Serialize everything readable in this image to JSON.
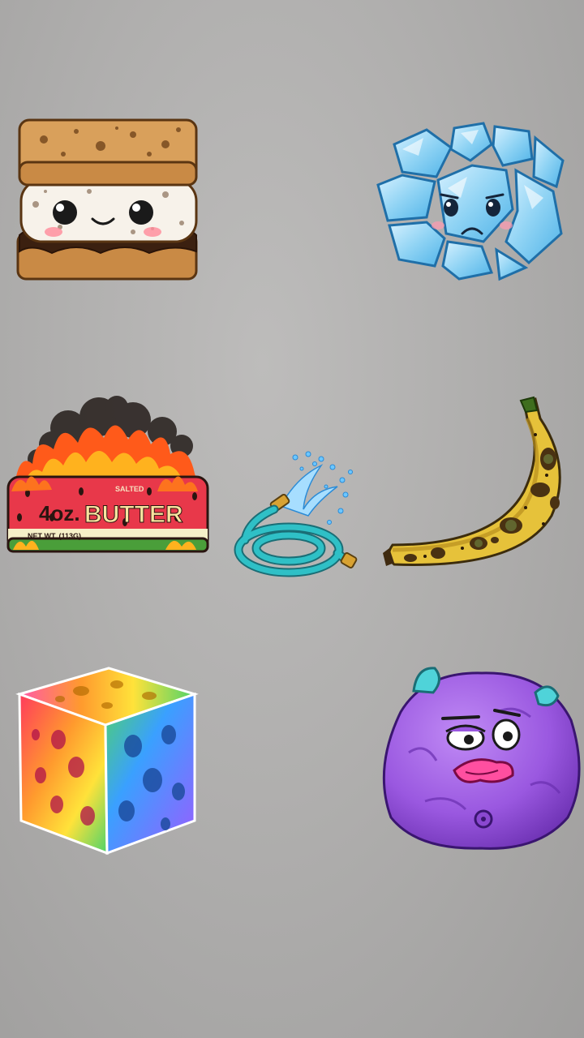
{
  "colors": {
    "wall": "#b0afae",
    "graham": "#d9a05b",
    "marshmallow": "#f7f2ea",
    "chocolate": "#3b2010",
    "ice": "#8fd3f4",
    "butter_red": "#e8384a",
    "hose": "#29a8b0",
    "banana": "#e6c23a",
    "sponge_rainbow": [
      "#ff3b5c",
      "#ff9a2e",
      "#ffe23a",
      "#4fd36a",
      "#3aa0ff",
      "#9b5cff"
    ],
    "blob": "#9a58e0"
  },
  "items": [
    {
      "name": "smores",
      "label": "S'more with face"
    },
    {
      "name": "ice",
      "label": "Cracked ice block with sad face"
    },
    {
      "name": "butter",
      "label": "Burning watermelon butter stick"
    },
    {
      "name": "hose",
      "label": "Garden hose spraying water"
    },
    {
      "name": "banana",
      "label": "Overripe spotted banana"
    },
    {
      "name": "sponge",
      "label": "Rainbow sponge cube"
    },
    {
      "name": "blob",
      "label": "Deflated purple blob face"
    }
  ],
  "butter": {
    "weight": "4oz.",
    "title": "BUTTER",
    "subtitle": "SALTED",
    "net_weight": "NET WT. (113G)"
  }
}
